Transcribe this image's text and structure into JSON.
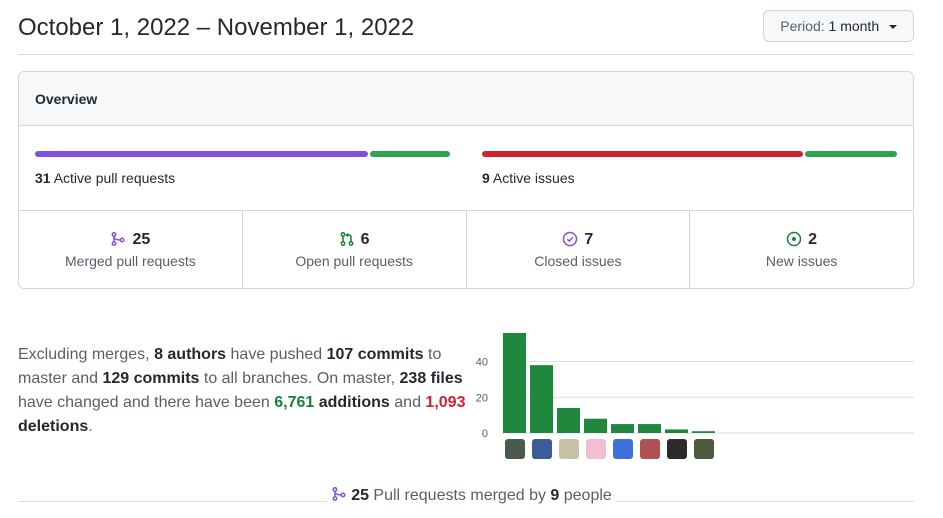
{
  "header": {
    "title": "October 1, 2022 – November 1, 2022",
    "period_label": "Period:",
    "period_value": "1 month"
  },
  "overview": {
    "heading": "Overview",
    "pull_requests": {
      "count": "31",
      "label": "Active pull requests",
      "merged_fraction": 0.806,
      "open_fraction": 0.194,
      "colors": [
        "#8250df",
        "#2da44e"
      ]
    },
    "issues": {
      "count": "9",
      "label": "Active issues",
      "closed_fraction": 0.778,
      "new_fraction": 0.222,
      "colors": [
        "#cf222e",
        "#2da44e"
      ]
    },
    "stats": [
      {
        "icon": "git-merge-icon",
        "count": "25",
        "label": "Merged pull requests",
        "color": "#8250df"
      },
      {
        "icon": "git-pull-request-icon",
        "count": "6",
        "label": "Open pull requests",
        "color": "#1a7f37"
      },
      {
        "icon": "issue-closed-icon",
        "count": "7",
        "label": "Closed issues",
        "color": "#8250df"
      },
      {
        "icon": "issue-opened-icon",
        "count": "2",
        "label": "New issues",
        "color": "#1a7f37"
      }
    ]
  },
  "summary": {
    "t1": "Excluding merges, ",
    "authors": "8 authors",
    "t2": " have pushed ",
    "commits_master": "107 commits",
    "t3": " to master and ",
    "commits_all": "129 commits",
    "t4": " to all branches. On master, ",
    "files": "238 files",
    "t5": " have changed and there have been ",
    "additions_num": "6,761",
    "additions_word": " additions",
    "t6": " and ",
    "deletions_num": "1,093",
    "deletions_word": " deletions",
    "t7": "."
  },
  "chart_data": {
    "type": "bar",
    "categories": [
      "contributor 1",
      "contributor 2",
      "contributor 3",
      "contributor 4",
      "contributor 5",
      "contributor 6",
      "contributor 7",
      "contributor 8"
    ],
    "values": [
      56,
      38,
      14,
      8,
      5,
      5,
      2,
      1
    ],
    "yticks": [
      0,
      20,
      40
    ],
    "ylim": [
      0,
      56
    ],
    "bar_color": "#1f883d",
    "xlabel": "",
    "ylabel": ""
  },
  "footer": {
    "count": "25",
    "mid": " Pull requests merged by ",
    "people": "9",
    "end": " people"
  }
}
